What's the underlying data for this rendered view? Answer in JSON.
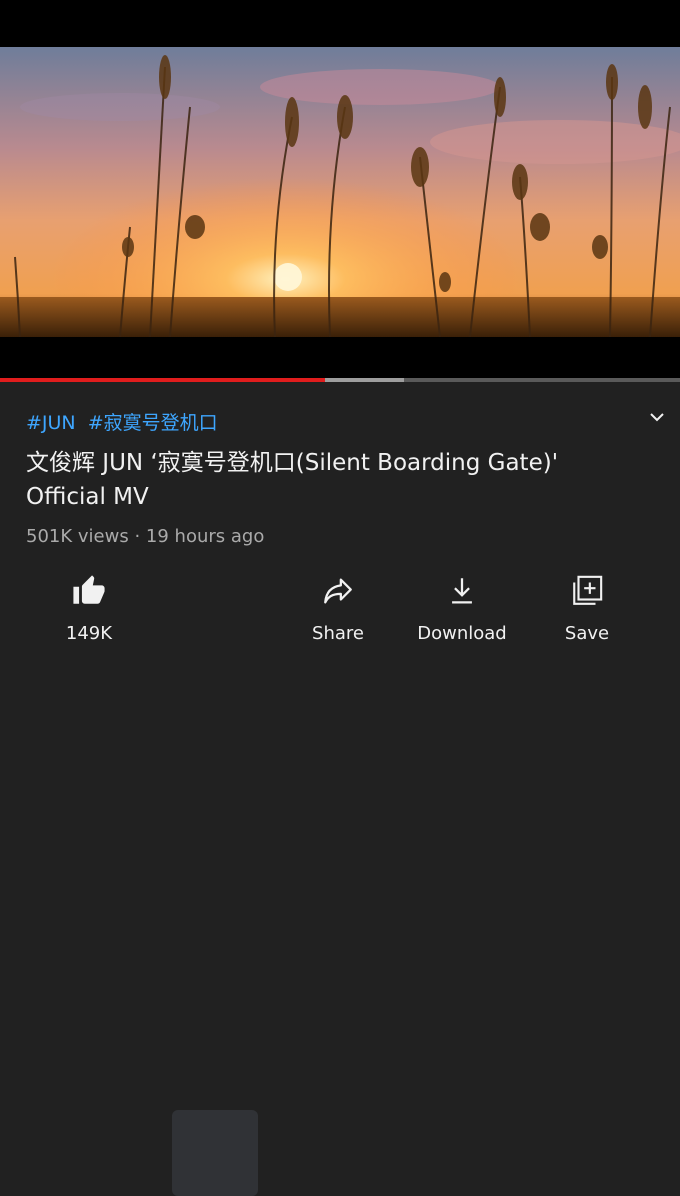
{
  "player": {
    "played_fraction": 0.478,
    "buffered_fraction": 0.594,
    "colors": {
      "played": "#e11d1d",
      "buffered": "#9e9e9e",
      "track": "#5a5a5a"
    }
  },
  "video": {
    "hashtags": [
      "#JUN",
      "#寂寞号登机口"
    ],
    "title": "文俊辉 JUN ‘寂寞号登机口(Silent Boarding Gate)' Official MV",
    "views": "501K views",
    "separator": "·",
    "posted": "19 hours ago"
  },
  "actions": {
    "like": {
      "label": "149K",
      "icon": "thumbs-up-icon"
    },
    "share": {
      "label": "Share",
      "icon": "share-icon"
    },
    "download": {
      "label": "Download",
      "icon": "download-icon"
    },
    "save": {
      "label": "Save",
      "icon": "add-to-playlist-icon"
    }
  },
  "colors": {
    "background": "#212121",
    "hashtag": "#3ea6ff",
    "meta": "#aaaaaa"
  }
}
